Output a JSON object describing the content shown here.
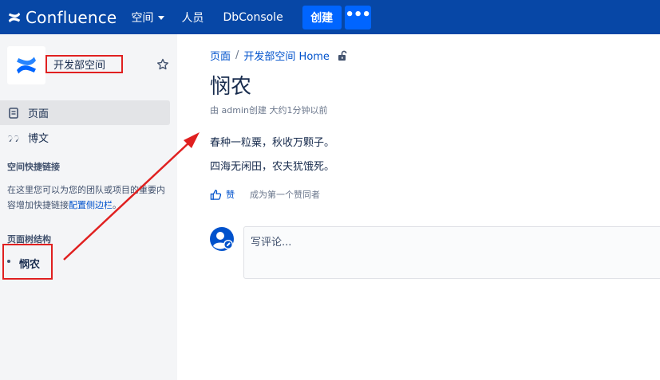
{
  "topbar": {
    "brand": "Confluence",
    "spaces_label": "空间",
    "people_label": "人员",
    "dbconsole_label": "DbConsole",
    "create_label": "创建",
    "more_label": "•••"
  },
  "sidebar": {
    "space_name": "开发部空间",
    "pages_label": "页面",
    "blog_label": "博文",
    "shortcuts_heading": "空间快捷链接",
    "shortcuts_text": "在这里您可以为您的团队或项目的重要内容增加快捷链接",
    "shortcuts_link": "配置侧边栏",
    "shortcuts_end": "。",
    "tree_heading": "页面树结构",
    "tree_items": [
      {
        "label": "悯农"
      }
    ]
  },
  "breadcrumb": {
    "item1": "页面",
    "separator": "/",
    "item2": "开发部空间 Home"
  },
  "page": {
    "title": "悯农",
    "byline": "由 admin创建 大约1分钟以前",
    "lines": [
      "春种一粒粟，秋收万颗子。",
      "四海无闲田，农夫犹饿死。"
    ],
    "like_label": "赞",
    "like_prompt": "成为第一个赞同者"
  },
  "comment": {
    "placeholder": "写评论..."
  },
  "colors": {
    "topbar": "#0747a6",
    "button": "#0065ff",
    "link": "#0052cc",
    "annotation": "#e02020"
  },
  "icons": [
    "confluence-logo-icon",
    "star-icon",
    "page-icon",
    "quote-icon",
    "unlock-icon",
    "thumbs-up-icon",
    "user-avatar-icon"
  ]
}
